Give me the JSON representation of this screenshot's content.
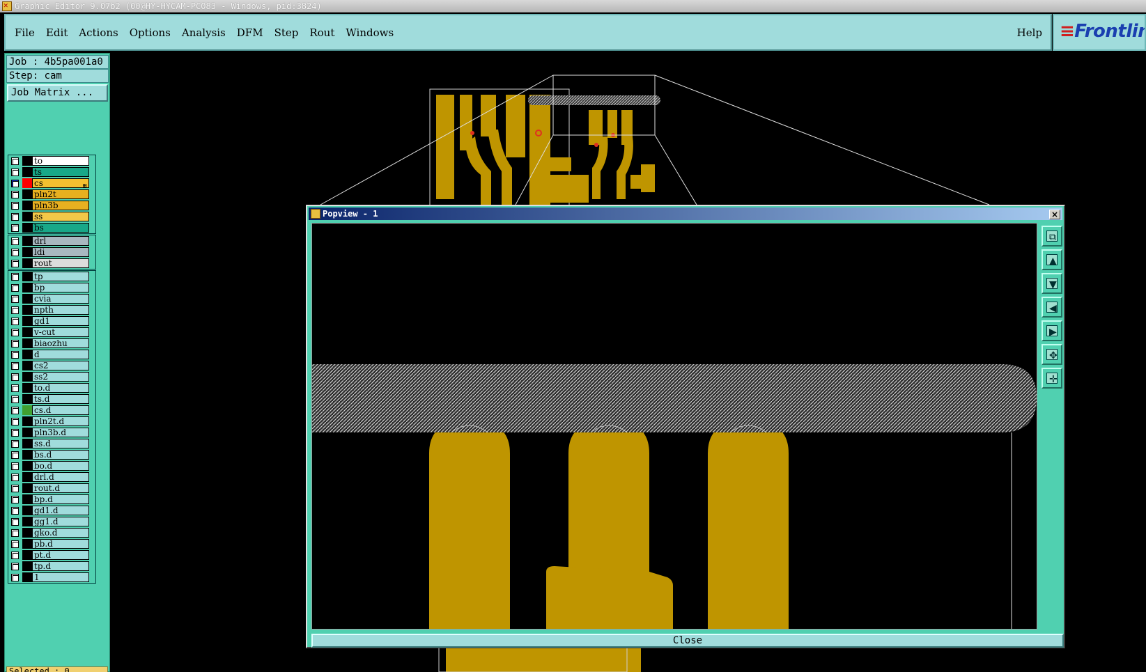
{
  "os_titlebar": {
    "title": "Graphic Editor 9.07b2 (00@HY-HYCAM-PC083 - Windows, pid:3824)"
  },
  "menubar": {
    "items": [
      {
        "id": "file",
        "label": "File"
      },
      {
        "id": "edit",
        "label": "Edit"
      },
      {
        "id": "actions",
        "label": "Actions"
      },
      {
        "id": "options",
        "label": "Options"
      },
      {
        "id": "analysis",
        "label": "Analysis"
      },
      {
        "id": "dfm",
        "label": "DFM"
      },
      {
        "id": "step",
        "label": "Step"
      },
      {
        "id": "rout",
        "label": "Rout"
      },
      {
        "id": "windows",
        "label": "Windows"
      }
    ],
    "help": "Help"
  },
  "brand": {
    "logo_text": "Frontlin"
  },
  "left_panel": {
    "job_line": "Job : 4b5pa001a0",
    "step_line": "Step: cam",
    "job_matrix_button": "Job Matrix ...",
    "selected_status": "Selected : 0",
    "layer_groups": [
      [
        {
          "name": "to",
          "color": "#ffffff"
        },
        {
          "name": "ts",
          "color": "#18a888"
        },
        {
          "name": "cs",
          "color": "#f4c030",
          "selected": true
        },
        {
          "name": "pln2t",
          "color": "#e8b020"
        },
        {
          "name": "pln3b",
          "color": "#e8b020"
        },
        {
          "name": "ss",
          "color": "#f4c848"
        },
        {
          "name": "bs",
          "color": "#18a888"
        }
      ],
      [
        {
          "name": "drl",
          "color": "#a8b8c0"
        },
        {
          "name": "ldi",
          "color": "#a8b8c0"
        },
        {
          "name": "rout",
          "color": "#dcdcdc"
        }
      ],
      [
        {
          "name": "tp",
          "color": "#a0dcdc"
        },
        {
          "name": "bp",
          "color": "#a0dcdc"
        },
        {
          "name": "cvia",
          "color": "#a0dcdc"
        },
        {
          "name": "npth",
          "color": "#a0dcdc"
        },
        {
          "name": "gd1",
          "color": "#a0dcdc"
        },
        {
          "name": "v-cut",
          "color": "#a0dcdc"
        },
        {
          "name": "biaozhu",
          "color": "#a0dcdc"
        },
        {
          "name": "d",
          "color": "#a0dcdc"
        },
        {
          "name": "cs2",
          "color": "#a0dcdc"
        },
        {
          "name": "ss2",
          "color": "#a0dcdc"
        },
        {
          "name": "to.d",
          "color": "#a0dcdc"
        },
        {
          "name": "ts.d",
          "color": "#a0dcdc"
        },
        {
          "name": "cs.d",
          "color": "#a0dcdc",
          "green_bar": true
        },
        {
          "name": "pln2t.d",
          "color": "#a0dcdc"
        },
        {
          "name": "pln3b.d",
          "color": "#a0dcdc"
        },
        {
          "name": "ss.d",
          "color": "#a0dcdc"
        },
        {
          "name": "bs.d",
          "color": "#a0dcdc"
        },
        {
          "name": "bo.d",
          "color": "#a0dcdc"
        },
        {
          "name": "drl.d",
          "color": "#a0dcdc"
        },
        {
          "name": "rout.d",
          "color": "#a0dcdc"
        },
        {
          "name": "bp.d",
          "color": "#a0dcdc"
        },
        {
          "name": "gd1.d",
          "color": "#a0dcdc"
        },
        {
          "name": "gg1.d",
          "color": "#a0dcdc"
        },
        {
          "name": "gko.d",
          "color": "#a0dcdc"
        },
        {
          "name": "pb.d",
          "color": "#a0dcdc"
        },
        {
          "name": "pt.d",
          "color": "#a0dcdc"
        },
        {
          "name": "tp.d",
          "color": "#a0dcdc"
        },
        {
          "name": "1",
          "color": "#a0dcdc"
        }
      ]
    ]
  },
  "popview": {
    "title": "Popview - 1",
    "close_x": "×",
    "close_button": "Close",
    "tools": [
      {
        "icon": "zoom-window-icon",
        "glyph": "⧉"
      },
      {
        "icon": "pan-up-icon",
        "glyph": "▲"
      },
      {
        "icon": "pan-down-icon",
        "glyph": "▼"
      },
      {
        "icon": "pan-left-icon",
        "glyph": "◀"
      },
      {
        "icon": "pan-right-icon",
        "glyph": "▶"
      },
      {
        "icon": "zoom-out-icon",
        "glyph": "✥"
      },
      {
        "icon": "zoom-in-icon",
        "glyph": "✛"
      }
    ]
  },
  "colors": {
    "copper": "#bf9500",
    "pad_red": "#e03020",
    "panel_teal": "#50d0b0",
    "menu_teal": "#a0dcdc"
  }
}
